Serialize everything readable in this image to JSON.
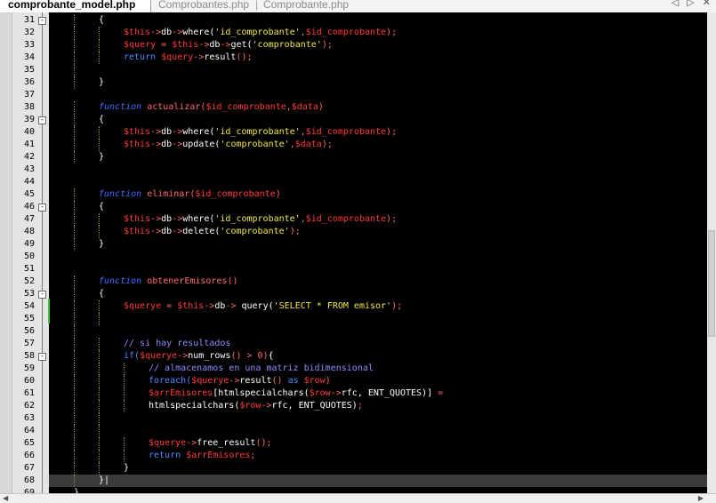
{
  "tabs": [
    {
      "label": "comprobante_model.php",
      "active": true
    },
    {
      "label": "Comprobantes.php",
      "active": false
    },
    {
      "label": "Comprobante.php",
      "active": false
    }
  ],
  "nav": {
    "prev": "◁",
    "next": "▷",
    "close": "✕"
  },
  "colors": {
    "keyword": "#3f6bff",
    "variable": "#ff3a3a",
    "string": "#f2e84a",
    "comment": "#8c8cff",
    "background": "#000000",
    "current_line": "#3b3b3b"
  },
  "lines": [
    {
      "n": "31",
      "fold": "-",
      "indent": 1,
      "tokens": [
        [
          "plain",
          "{"
        ]
      ]
    },
    {
      "n": "32",
      "indent": 2,
      "tokens": [
        [
          "var",
          "$this"
        ],
        [
          "op",
          "->"
        ],
        [
          "plain",
          "db"
        ],
        [
          "op",
          "->"
        ],
        [
          "plain",
          "where("
        ],
        [
          "str",
          "'id_comprobante'"
        ],
        [
          "op",
          ","
        ],
        [
          "var",
          "$id_comprobante"
        ],
        [
          "op",
          ");"
        ]
      ]
    },
    {
      "n": "33",
      "indent": 2,
      "tokens": [
        [
          "var",
          "$query"
        ],
        [
          "op",
          " = "
        ],
        [
          "var",
          "$this"
        ],
        [
          "op",
          "->"
        ],
        [
          "plain",
          "db"
        ],
        [
          "op",
          "->"
        ],
        [
          "plain",
          "get("
        ],
        [
          "str",
          "'comprobante'"
        ],
        [
          "op",
          ");"
        ]
      ]
    },
    {
      "n": "34",
      "indent": 2,
      "tokens": [
        [
          "kw2",
          "return "
        ],
        [
          "var",
          "$query"
        ],
        [
          "op",
          "->"
        ],
        [
          "plain",
          "result"
        ],
        [
          "op",
          "();"
        ]
      ]
    },
    {
      "n": "35",
      "indent": 1,
      "tokens": []
    },
    {
      "n": "36",
      "indent": 1,
      "tokens": [
        [
          "plain",
          "}"
        ]
      ]
    },
    {
      "n": "37",
      "indent": 0,
      "tokens": []
    },
    {
      "n": "38",
      "indent": 1,
      "tokens": [
        [
          "kw",
          "function "
        ],
        [
          "fn",
          "actualizar("
        ],
        [
          "var",
          "$id_comprobante"
        ],
        [
          "op",
          ","
        ],
        [
          "var",
          "$data"
        ],
        [
          "op",
          ")"
        ]
      ]
    },
    {
      "n": "39",
      "fold": "-",
      "indent": 1,
      "tokens": [
        [
          "plain",
          "{"
        ]
      ]
    },
    {
      "n": "40",
      "indent": 2,
      "tokens": [
        [
          "var",
          "$this"
        ],
        [
          "op",
          "->"
        ],
        [
          "plain",
          "db"
        ],
        [
          "op",
          "->"
        ],
        [
          "plain",
          "where("
        ],
        [
          "str",
          "'id_comprobante'"
        ],
        [
          "op",
          ","
        ],
        [
          "var",
          "$id_comprobante"
        ],
        [
          "op",
          ");"
        ]
      ]
    },
    {
      "n": "41",
      "indent": 2,
      "tokens": [
        [
          "var",
          "$this"
        ],
        [
          "op",
          "->"
        ],
        [
          "plain",
          "db"
        ],
        [
          "op",
          "->"
        ],
        [
          "plain",
          "update("
        ],
        [
          "str",
          "'comprobante'"
        ],
        [
          "op",
          ","
        ],
        [
          "var",
          "$data"
        ],
        [
          "op",
          ");"
        ]
      ]
    },
    {
      "n": "42",
      "indent": 1,
      "tokens": [
        [
          "plain",
          "}"
        ]
      ]
    },
    {
      "n": "43",
      "indent": 0,
      "tokens": []
    },
    {
      "n": "44",
      "indent": 0,
      "tokens": []
    },
    {
      "n": "45",
      "indent": 1,
      "tokens": [
        [
          "kw",
          "function "
        ],
        [
          "fn",
          "eliminar("
        ],
        [
          "var",
          "$id_comprobante"
        ],
        [
          "op",
          ")"
        ]
      ]
    },
    {
      "n": "46",
      "fold": "-",
      "indent": 1,
      "tokens": [
        [
          "plain",
          "{"
        ]
      ]
    },
    {
      "n": "47",
      "indent": 2,
      "tokens": [
        [
          "var",
          "$this"
        ],
        [
          "op",
          "->"
        ],
        [
          "plain",
          "db"
        ],
        [
          "op",
          "->"
        ],
        [
          "plain",
          "where("
        ],
        [
          "str",
          "'id_comprobante'"
        ],
        [
          "op",
          ","
        ],
        [
          "var",
          "$id_comprobante"
        ],
        [
          "op",
          ");"
        ]
      ]
    },
    {
      "n": "48",
      "indent": 2,
      "tokens": [
        [
          "var",
          "$this"
        ],
        [
          "op",
          "->"
        ],
        [
          "plain",
          "db"
        ],
        [
          "op",
          "->"
        ],
        [
          "plain",
          "delete("
        ],
        [
          "str",
          "'comprobante'"
        ],
        [
          "op",
          ");"
        ]
      ]
    },
    {
      "n": "49",
      "indent": 1,
      "tokens": [
        [
          "plain",
          "}"
        ]
      ]
    },
    {
      "n": "50",
      "indent": 0,
      "tokens": []
    },
    {
      "n": "51",
      "indent": 0,
      "tokens": []
    },
    {
      "n": "52",
      "indent": 1,
      "tokens": [
        [
          "kw",
          "function "
        ],
        [
          "fn",
          "obtenerEmisores()"
        ]
      ]
    },
    {
      "n": "53",
      "fold": "-",
      "indent": 1,
      "tokens": [
        [
          "plain",
          "{"
        ]
      ]
    },
    {
      "n": "54",
      "indent": 2,
      "tokens": [
        [
          "var",
          "$querye"
        ],
        [
          "op",
          " = "
        ],
        [
          "var",
          "$this"
        ],
        [
          "op",
          "->"
        ],
        [
          "plain",
          "db"
        ],
        [
          "op",
          "-> "
        ],
        [
          "plain",
          "query("
        ],
        [
          "str",
          "'SELECT * FROM emisor'"
        ],
        [
          "op",
          ");"
        ]
      ]
    },
    {
      "n": "55",
      "indent": 2,
      "tokens": []
    },
    {
      "n": "56",
      "indent": 1,
      "tokens": []
    },
    {
      "n": "57",
      "indent": 2,
      "tokens": [
        [
          "com",
          "// si hay resultados"
        ]
      ]
    },
    {
      "n": "58",
      "fold": "-",
      "indent": 2,
      "tokens": [
        [
          "kw2",
          "if("
        ],
        [
          "var",
          "$querye"
        ],
        [
          "op",
          "->"
        ],
        [
          "plain",
          "num_rows"
        ],
        [
          "op",
          "() > "
        ],
        [
          "num",
          "0"
        ],
        [
          "op",
          ")"
        ],
        [
          "plain",
          "{"
        ]
      ]
    },
    {
      "n": "59",
      "indent": 3,
      "tokens": [
        [
          "com",
          "// almacenamos en una matriz bidimensional"
        ]
      ]
    },
    {
      "n": "60",
      "indent": 3,
      "tokens": [
        [
          "kw2",
          "foreach("
        ],
        [
          "var",
          "$querye"
        ],
        [
          "op",
          "->"
        ],
        [
          "plain",
          "result"
        ],
        [
          "op",
          "() "
        ],
        [
          "kw2",
          "as "
        ],
        [
          "var",
          "$row"
        ],
        [
          "op",
          ")"
        ]
      ]
    },
    {
      "n": "61",
      "indent": 3,
      "tokens": [
        [
          "var",
          "$arrEmisores"
        ],
        [
          "plain",
          "[htmlspecialchars("
        ],
        [
          "var",
          "$row"
        ],
        [
          "op",
          "->"
        ],
        [
          "plain",
          "rfc, ENT_QUOTES)]"
        ],
        [
          "op",
          " ="
        ]
      ]
    },
    {
      "n": "62",
      "indent": 3,
      "tokens": [
        [
          "plain",
          "htmlspecialchars("
        ],
        [
          "var",
          "$row"
        ],
        [
          "op",
          "->"
        ],
        [
          "plain",
          "rfc, ENT_QUOTES)"
        ],
        [
          "op",
          ";"
        ]
      ]
    },
    {
      "n": "63",
      "indent": 2,
      "tokens": []
    },
    {
      "n": "64",
      "indent": 2,
      "tokens": []
    },
    {
      "n": "65",
      "indent": 3,
      "tokens": [
        [
          "var",
          "$querye"
        ],
        [
          "op",
          "->"
        ],
        [
          "plain",
          "free_result"
        ],
        [
          "op",
          "();"
        ]
      ]
    },
    {
      "n": "66",
      "indent": 3,
      "tokens": [
        [
          "kw2",
          "return "
        ],
        [
          "var",
          "$arrEmisores"
        ],
        [
          "op",
          ";"
        ]
      ]
    },
    {
      "n": "67",
      "indent": 2,
      "tokens": [
        [
          "plain",
          "}"
        ]
      ]
    },
    {
      "n": "68",
      "indent": 1,
      "current": true,
      "tokens": [
        [
          "plain",
          "}"
        ],
        [
          "plain",
          "|"
        ]
      ]
    },
    {
      "n": "69",
      "indent": 0,
      "tokens": [
        [
          "plain",
          "}"
        ]
      ]
    }
  ]
}
